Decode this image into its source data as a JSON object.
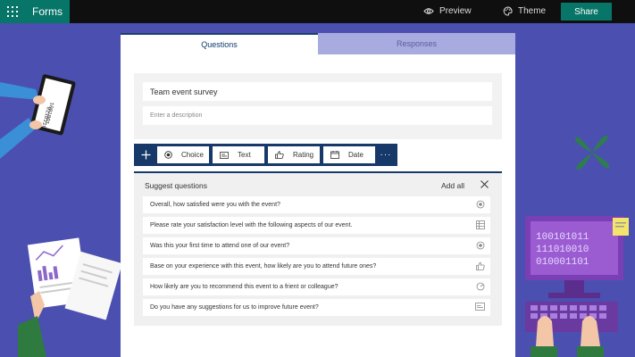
{
  "topbar": {
    "app_name": "Forms",
    "preview_label": "Preview",
    "theme_label": "Theme",
    "share_label": "Share"
  },
  "tabs": [
    {
      "label": "Questions",
      "active": true
    },
    {
      "label": "Responses",
      "active": false
    }
  ],
  "form": {
    "title": "Team event survey",
    "description_placeholder": "Enter a description"
  },
  "toolbar": {
    "add_icon": "plus-icon",
    "buttons": [
      {
        "label": "Choice",
        "icon": "radio-icon"
      },
      {
        "label": "Text",
        "icon": "text-icon"
      },
      {
        "label": "Rating",
        "icon": "thumbs-up-icon"
      },
      {
        "label": "Date",
        "icon": "calendar-icon"
      }
    ],
    "more_label": "···"
  },
  "suggest": {
    "title": "Suggest questions",
    "add_all_label": "Add all",
    "close_icon": "close-icon",
    "items": [
      {
        "text": "Overall, how satisfied were you with the event?",
        "icon": "radio-icon"
      },
      {
        "text": "Please rate your satisfaction level with the following aspects of our event.",
        "icon": "grid-icon"
      },
      {
        "text": "Was this your first time to attend one of our event?",
        "icon": "radio-icon"
      },
      {
        "text": "Base on your experience with this event, how likely are you to attend future ones?",
        "icon": "thumbs-up-icon"
      },
      {
        "text": "How likely are you to recommend this event to a frient or colleague?",
        "icon": "gauge-icon"
      },
      {
        "text": "Do you have any suggestions for us to improve future event?",
        "icon": "text-icon"
      }
    ]
  },
  "decor": {
    "binary_lines": [
      "100101011",
      "111010010",
      "010001101"
    ],
    "tablet_lines": [
      "1001001",
      "0110110"
    ]
  },
  "colors": {
    "background": "#4b4fb0",
    "topbar": "#0f0f0f",
    "accent": "#077568",
    "toolbar": "#16396a",
    "tab_inactive": "#a7abdf"
  }
}
